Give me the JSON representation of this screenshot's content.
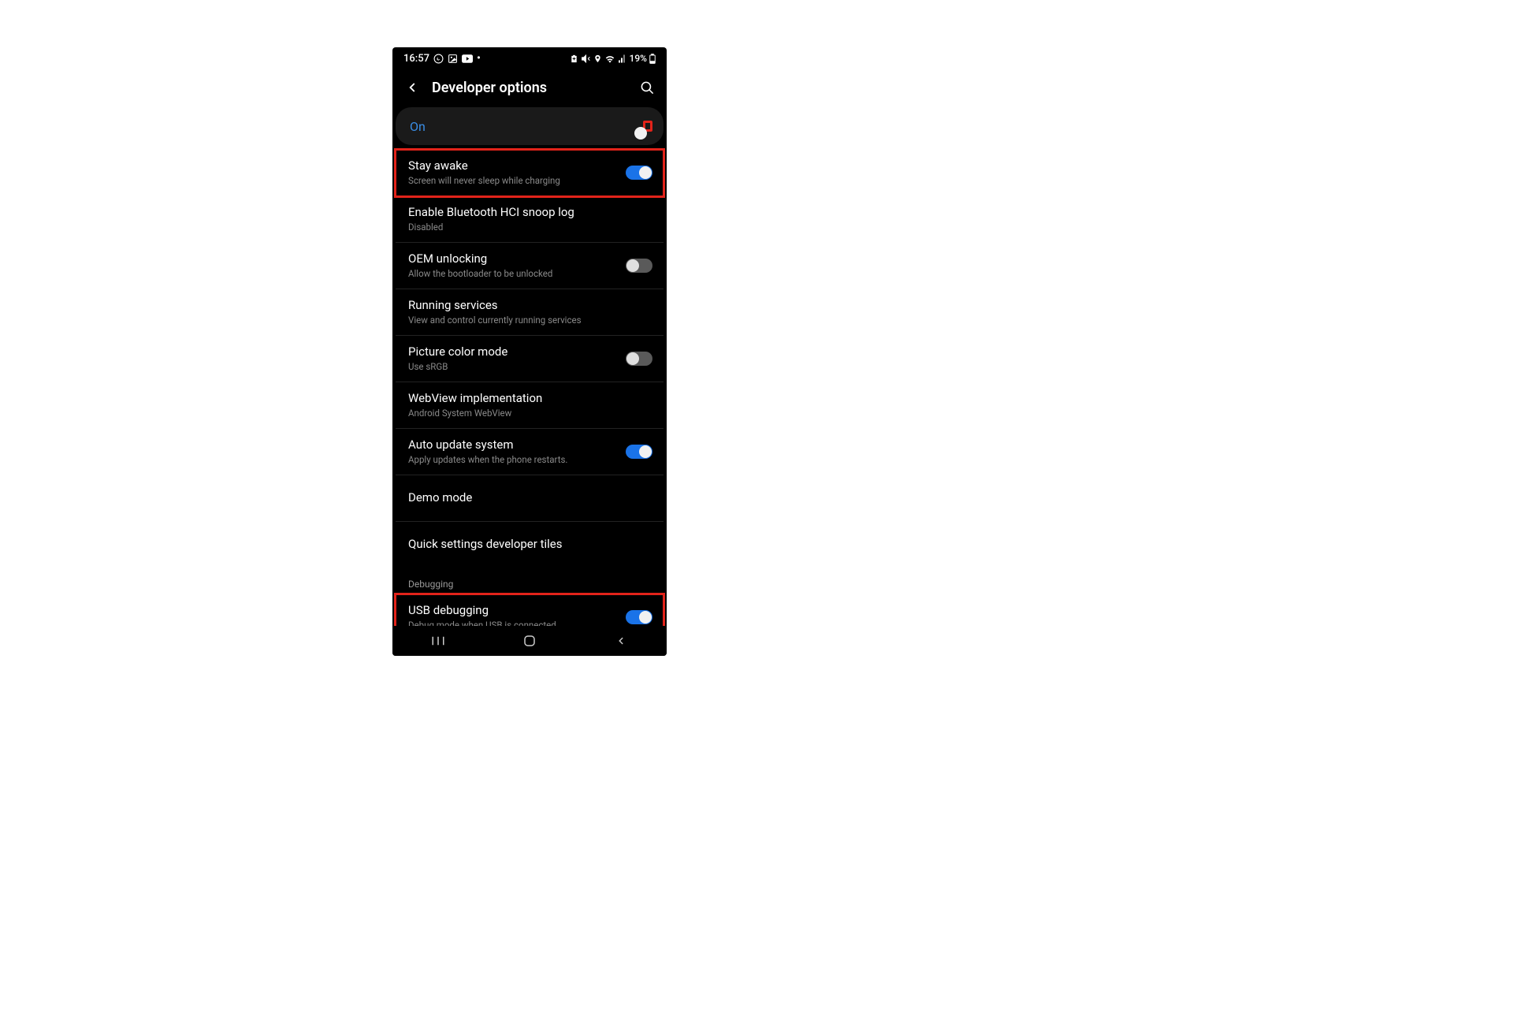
{
  "status": {
    "time": "16:57",
    "battery": "19%"
  },
  "header": {
    "title": "Developer options"
  },
  "master": {
    "label": "On",
    "on": true
  },
  "items": [
    {
      "title": "Stay awake",
      "sub": "Screen will never sleep while charging",
      "toggle": "on",
      "hilite": true
    },
    {
      "title": "Enable Bluetooth HCI snoop log",
      "sub": "Disabled"
    },
    {
      "title": "OEM unlocking",
      "sub": "Allow the bootloader to be unlocked",
      "toggle": "off"
    },
    {
      "title": "Running services",
      "sub": "View and control currently running services"
    },
    {
      "title": "Picture color mode",
      "sub": "Use sRGB",
      "toggle": "off"
    },
    {
      "title": "WebView implementation",
      "sub": "Android System WebView"
    },
    {
      "title": "Auto update system",
      "sub": "Apply updates when the phone restarts.",
      "toggle": "on"
    },
    {
      "title": "Demo mode"
    },
    {
      "title": "Quick settings developer tiles"
    }
  ],
  "section": "Debugging",
  "usb": {
    "title": "USB debugging",
    "sub": "Debug mode when USB is connected",
    "toggle": "on",
    "hilite": true
  }
}
